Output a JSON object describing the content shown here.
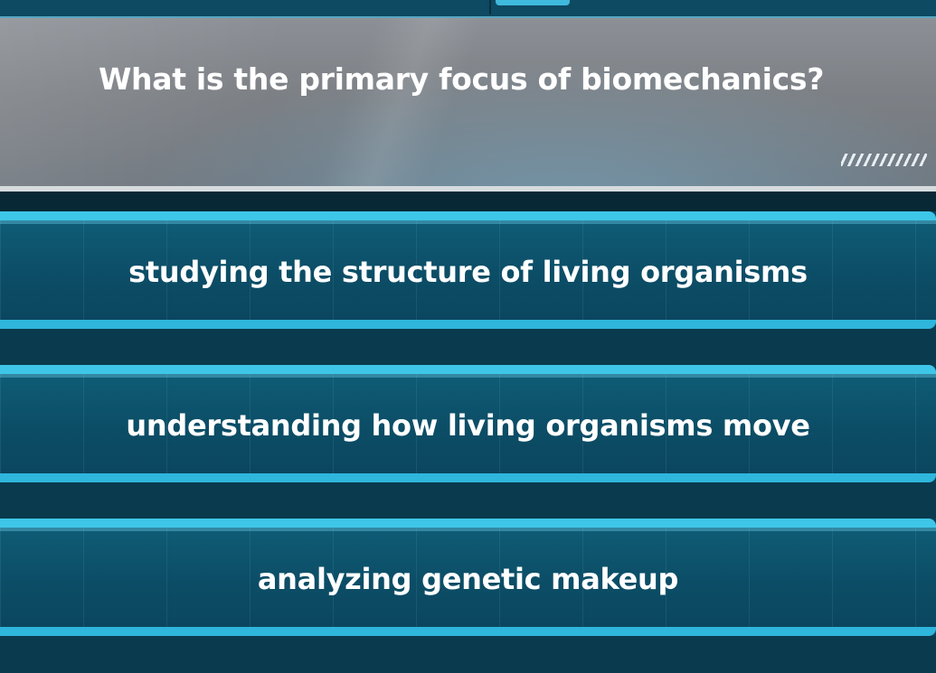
{
  "question": {
    "text": "What is the primary focus of biomechanics?"
  },
  "answers": [
    {
      "label": "studying the structure of living organisms"
    },
    {
      "label": "understanding how living organisms move"
    },
    {
      "label": "analyzing genetic makeup"
    }
  ],
  "colors": {
    "background": "#0a3a4e",
    "question_panel": "#7d8186",
    "answer_border": "#3ec6e8",
    "answer_fill": "#0c4d66",
    "text": "#ffffff"
  }
}
